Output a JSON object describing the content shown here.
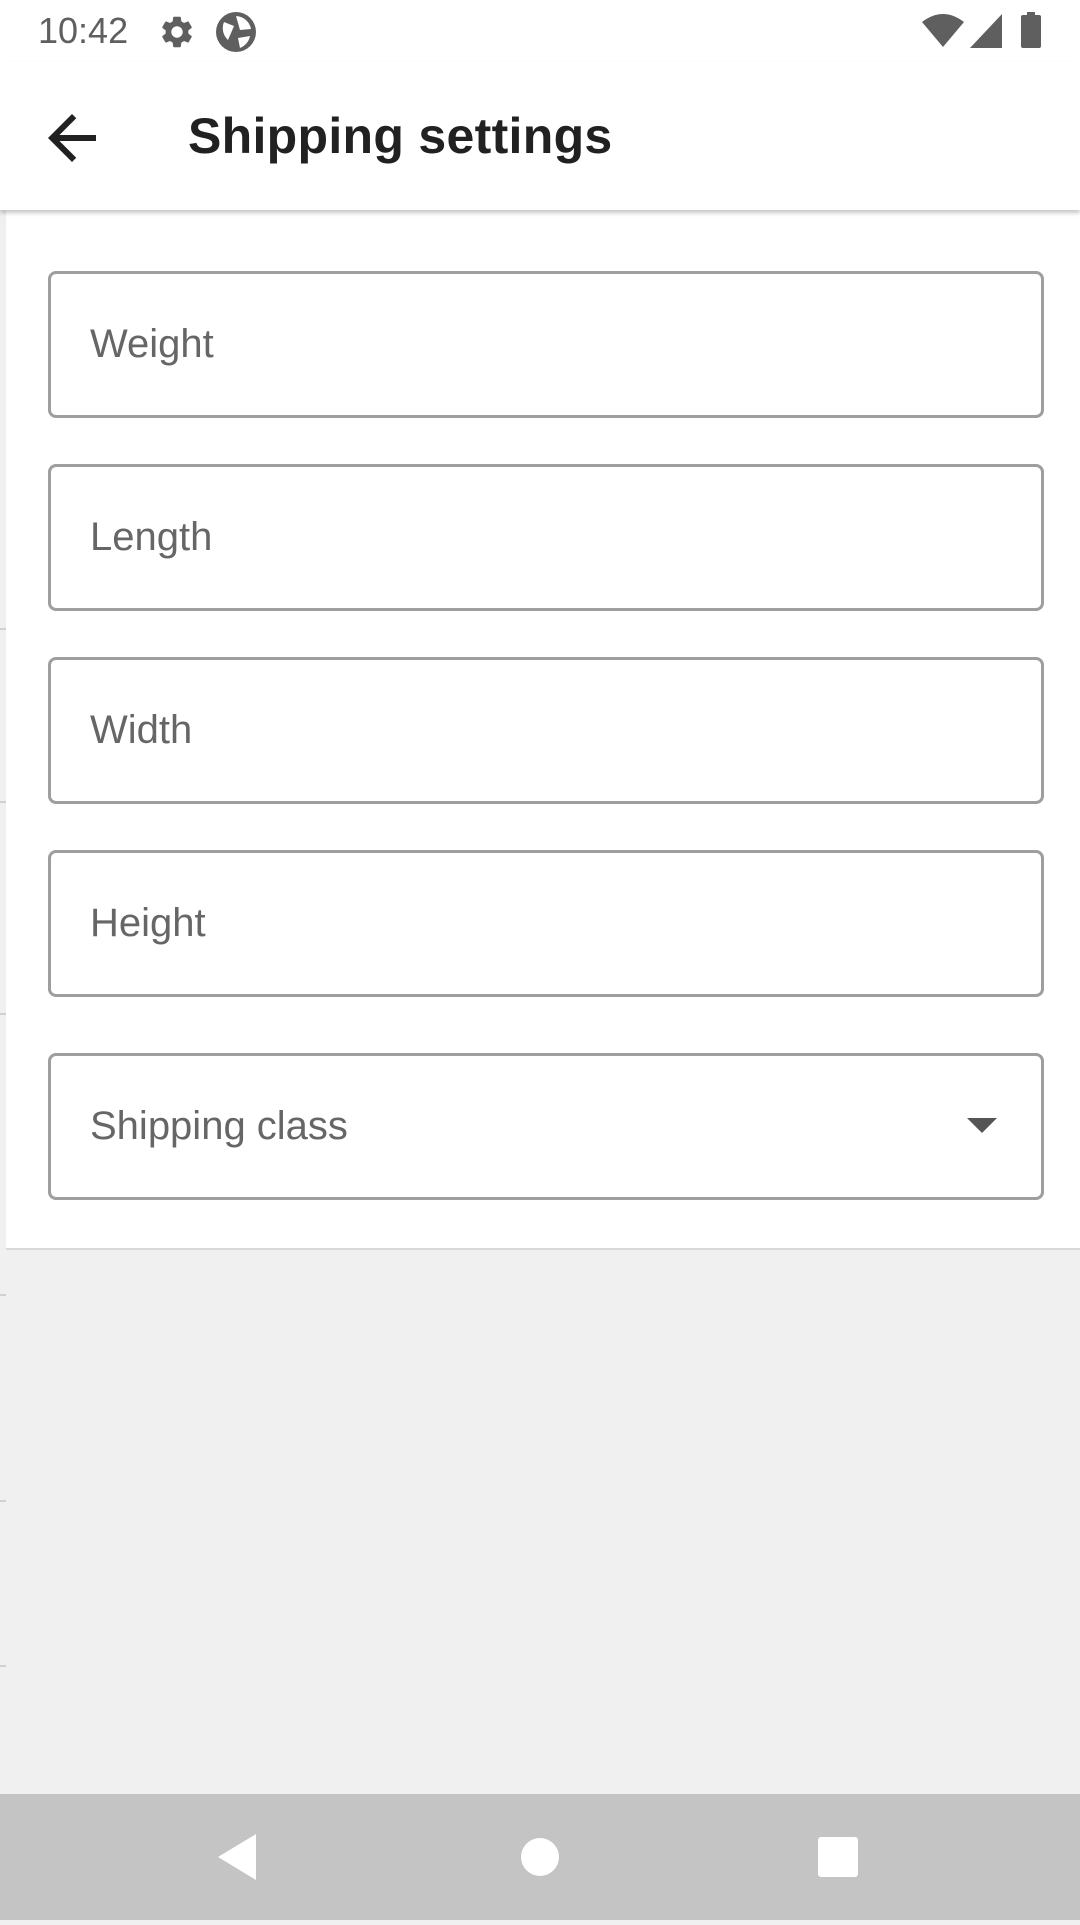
{
  "status_bar": {
    "time": "10:42",
    "icons_left": [
      "settings-icon",
      "app-status-icon"
    ],
    "icons_right": [
      "wifi-icon",
      "cell-signal-icon",
      "battery-icon"
    ]
  },
  "app_bar": {
    "back_icon": "arrow-back-icon",
    "title": "Shipping settings"
  },
  "form": {
    "weight": {
      "placeholder": "Weight",
      "value": ""
    },
    "length": {
      "placeholder": "Length",
      "value": ""
    },
    "width": {
      "placeholder": "Width",
      "value": ""
    },
    "height": {
      "placeholder": "Height",
      "value": ""
    },
    "shipping_class": {
      "placeholder": "Shipping class",
      "value": "",
      "icon": "dropdown-arrow-icon"
    }
  },
  "nav_bar": {
    "buttons": [
      "back-nav-icon",
      "home-nav-icon",
      "recents-nav-icon"
    ]
  },
  "colors": {
    "surface": "#ffffff",
    "background": "#f0f0f0",
    "field_border": "#9e9e9e",
    "label": "#666666",
    "title": "#212121",
    "nav_bar": "#c4c4c4"
  }
}
